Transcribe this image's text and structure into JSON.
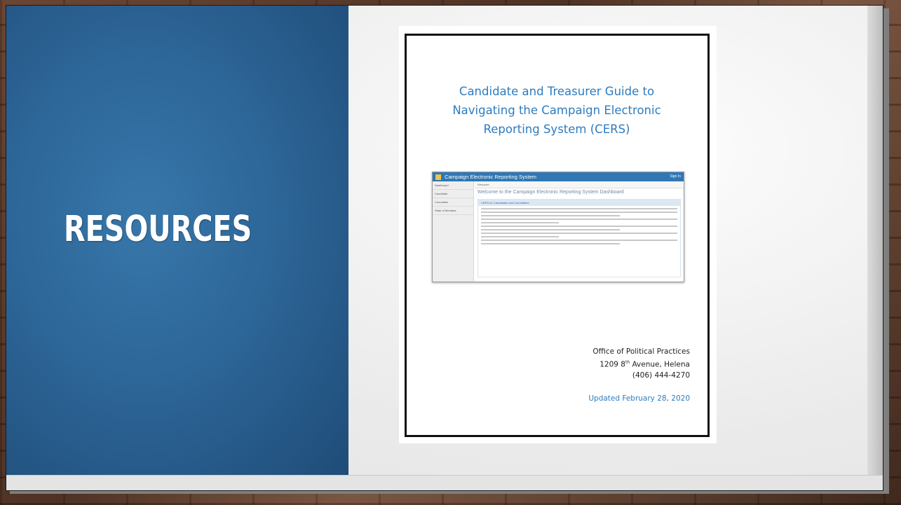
{
  "slide": {
    "title": "RESOURCES"
  },
  "document": {
    "title_lines": [
      "Candidate and Treasurer Guide to",
      "Navigating the Campaign Electronic",
      "Reporting System (CERS)"
    ],
    "screenshot": {
      "app_title": "Campaign Electronic Reporting System",
      "sign_in": "Sign In",
      "nav_items": [
        "Dashboard",
        "Candidate",
        "Committee",
        "State of Montana"
      ],
      "breadcrumb": "Welcome",
      "welcome_heading": "Welcome to the Campaign Electronic Reporting System Dashboard",
      "box_heading": "CERS for Candidates and Committees"
    },
    "address": {
      "org": "Office of Political Practices",
      "street_number": "1209 8",
      "street_suffix": "th",
      "street_rest": " Avenue, Helena",
      "phone": "(406) 444-4270"
    },
    "updated": "Updated February 28, 2020"
  },
  "colors": {
    "panel_blue": "#2d6698",
    "doc_title_blue": "#2e7cc0",
    "title_white": "#ffffff"
  }
}
